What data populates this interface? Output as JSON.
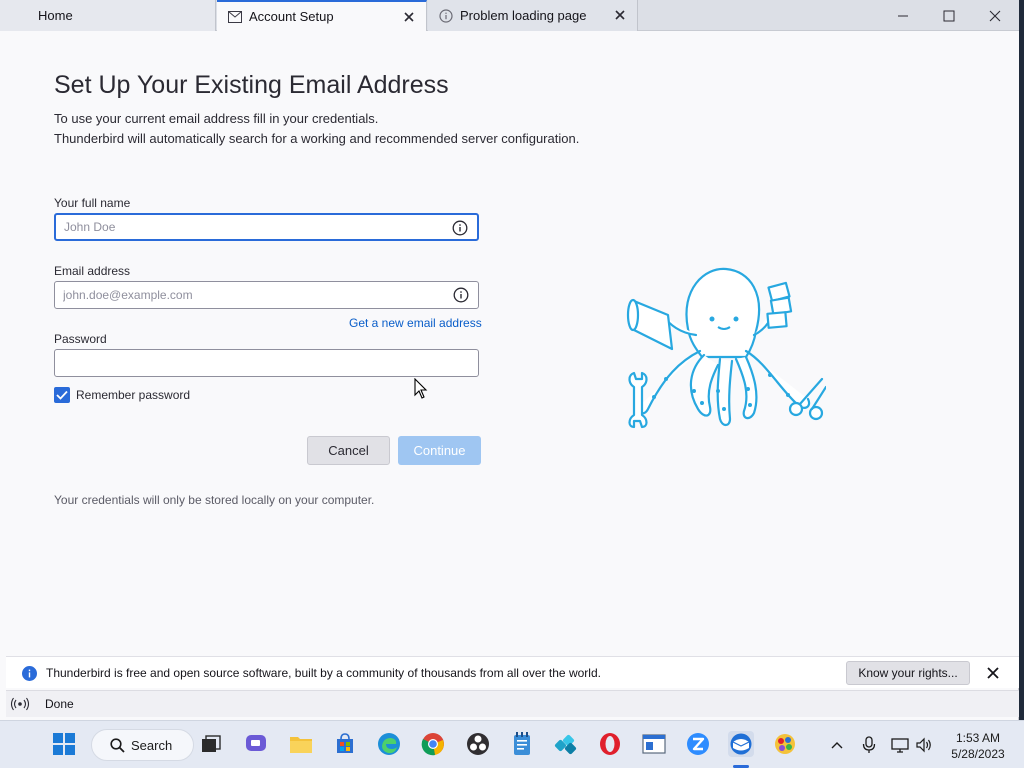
{
  "tabs": {
    "home": "Home",
    "account_setup": "Account Setup",
    "problem": "Problem loading page"
  },
  "form": {
    "heading": "Set Up Your Existing Email Address",
    "intro_line1": "To use your current email address fill in your credentials.",
    "intro_line2": "Thunderbird will automatically search for a working and recommended server configuration.",
    "name_label": "Your full name",
    "name_placeholder": "John Doe",
    "email_label": "Email address",
    "email_placeholder": "john.doe@example.com",
    "new_email_link": "Get a new email address",
    "password_label": "Password",
    "password_value": "",
    "remember_label": "Remember password",
    "remember_checked": true,
    "cancel_label": "Cancel",
    "continue_label": "Continue",
    "footnote": "Your credentials will only be stored locally on your computer."
  },
  "notification": {
    "text": "Thunderbird is free and open source software, built by a community of thousands from all over the world.",
    "button": "Know your rights..."
  },
  "status": {
    "text": "Done"
  },
  "taskbar": {
    "search_label": "Search",
    "time": "1:53 AM",
    "date": "5/28/2023"
  },
  "colors": {
    "accent": "#2a6bd9",
    "link": "#0a5ec9",
    "mascot": "#28a8e0"
  }
}
